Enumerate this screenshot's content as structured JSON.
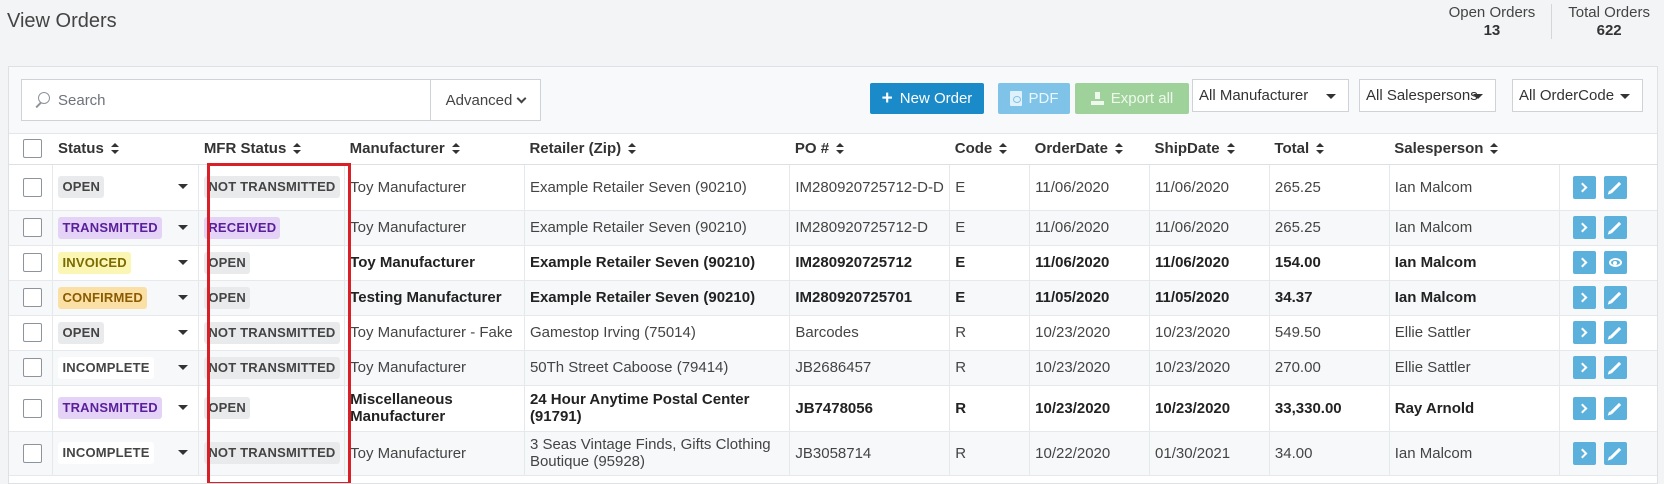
{
  "header": {
    "title": "View Orders",
    "stats": [
      {
        "label": "Open Orders",
        "value": "13"
      },
      {
        "label": "Total Orders",
        "value": "622"
      }
    ]
  },
  "toolbar": {
    "search_placeholder": "Search",
    "advanced_label": "Advanced",
    "new_order_label": "New Order",
    "pdf_label": "PDF",
    "export_label": "Export all",
    "filters": {
      "manufacturer": "All Manufacturer",
      "salesperson": "All Salespersons",
      "order_code": "All OrderCode"
    }
  },
  "table": {
    "columns": [
      "Status",
      "MFR Status",
      "Manufacturer",
      "Retailer (Zip)",
      "PO #",
      "Code",
      "OrderDate",
      "ShipDate",
      "Total",
      "Salesperson"
    ],
    "rows": [
      {
        "status": "OPEN",
        "status_style": "open",
        "mfr_status": "NOT TRANSMITTED",
        "mfr_style": "nottx",
        "manufacturer": "Toy Manufacturer",
        "retailer": "Example Retailer Seven (90210)",
        "po": "IM280920725712-D-D",
        "code": "E",
        "order_date": "11/06/2020",
        "ship_date": "11/06/2020",
        "total": "265.25",
        "salesperson": "Ian Malcom",
        "bold": false,
        "action": "edit"
      },
      {
        "status": "TRANSMITTED",
        "status_style": "transmitted",
        "mfr_status": "RECEIVED",
        "mfr_style": "received",
        "manufacturer": "Toy Manufacturer",
        "retailer": "Example Retailer Seven (90210)",
        "po": "IM280920725712-D",
        "code": "E",
        "order_date": "11/06/2020",
        "ship_date": "11/06/2020",
        "total": "265.25",
        "salesperson": "Ian Malcom",
        "bold": false,
        "action": "edit"
      },
      {
        "status": "INVOICED",
        "status_style": "invoiced",
        "mfr_status": "OPEN",
        "mfr_style": "open",
        "manufacturer": "Toy Manufacturer",
        "retailer": "Example Retailer Seven (90210)",
        "po": "IM280920725712",
        "code": "E",
        "order_date": "11/06/2020",
        "ship_date": "11/06/2020",
        "total": "154.00",
        "salesperson": "Ian Malcom",
        "bold": true,
        "action": "view"
      },
      {
        "status": "CONFIRMED",
        "status_style": "confirmed",
        "mfr_status": "OPEN",
        "mfr_style": "open",
        "manufacturer": "Testing Manufacturer",
        "retailer": "Example Retailer Seven (90210)",
        "po": "IM280920725701",
        "code": "E",
        "order_date": "11/05/2020",
        "ship_date": "11/05/2020",
        "total": "34.37",
        "salesperson": "Ian Malcom",
        "bold": true,
        "action": "edit"
      },
      {
        "status": "OPEN",
        "status_style": "open",
        "mfr_status": "NOT TRANSMITTED",
        "mfr_style": "nottx",
        "manufacturer": "Toy Manufacturer - Fake",
        "retailer": "Gamestop Irving (75014)",
        "po": "Barcodes",
        "code": "R",
        "order_date": "10/23/2020",
        "ship_date": "10/23/2020",
        "total": "549.50",
        "salesperson": "Ellie Sattler",
        "bold": false,
        "action": "edit"
      },
      {
        "status": "INCOMPLETE",
        "status_style": "incomplete",
        "mfr_status": "NOT TRANSMITTED",
        "mfr_style": "nottx",
        "manufacturer": "Toy Manufacturer",
        "retailer": "50Th Street Caboose (79414)",
        "po": "JB2686457",
        "code": "R",
        "order_date": "10/23/2020",
        "ship_date": "10/23/2020",
        "total": "270.00",
        "salesperson": "Ellie Sattler",
        "bold": false,
        "action": "edit"
      },
      {
        "status": "TRANSMITTED",
        "status_style": "transmitted",
        "mfr_status": "OPEN",
        "mfr_style": "open",
        "manufacturer": "Miscellaneous Manufacturer",
        "retailer": "24 Hour Anytime Postal Center (91791)",
        "po": "JB7478056",
        "code": "R",
        "order_date": "10/23/2020",
        "ship_date": "10/23/2020",
        "total": "33,330.00",
        "salesperson": "Ray Arnold",
        "bold": true,
        "action": "edit"
      },
      {
        "status": "INCOMPLETE",
        "status_style": "incomplete",
        "mfr_status": "NOT TRANSMITTED",
        "mfr_style": "nottx",
        "manufacturer": "Toy Manufacturer",
        "retailer": "3 Seas Vintage Finds, Gifts Clothing Boutique (95928)",
        "po": "JB3058714",
        "code": "R",
        "order_date": "10/22/2020",
        "ship_date": "01/30/2021",
        "total": "34.00",
        "salesperson": "Ian Malcom",
        "bold": false,
        "action": "edit"
      }
    ]
  },
  "colors": {
    "primary": "#1a8ac9",
    "pdf": "#7fc3e8",
    "export": "#9fd29a",
    "highlight_box": "#d92026",
    "action_button": "#5bb1dc"
  },
  "icons": [
    "search-icon",
    "chevron-down-icon",
    "plus-icon",
    "pdf-icon",
    "download-icon",
    "sort-icon",
    "chevron-right-icon",
    "pencil-icon",
    "eye-icon"
  ]
}
